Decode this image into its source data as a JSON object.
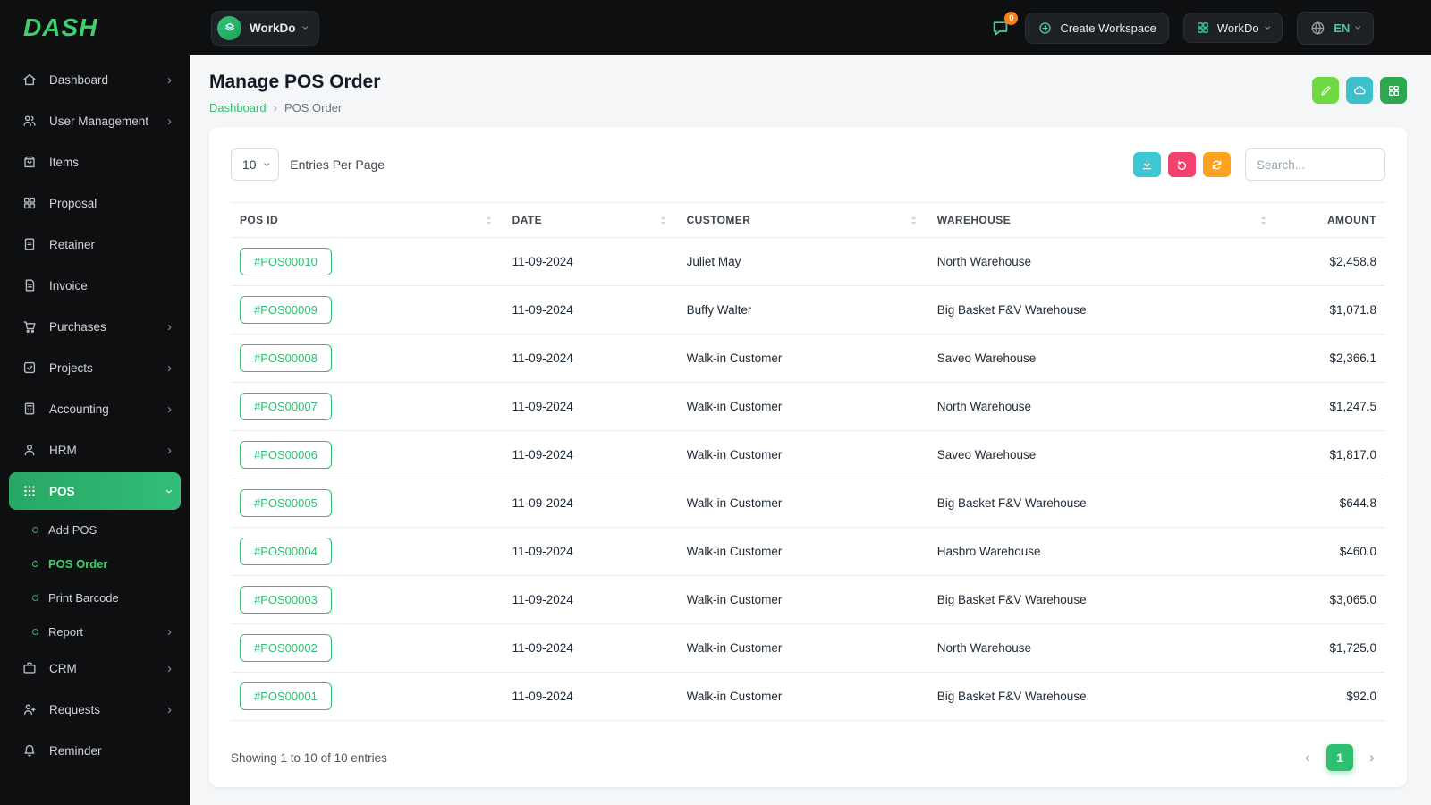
{
  "theme": {
    "accent_green": "#2fbf71",
    "brand_lime": "#6fd943",
    "sidebar_bg": "#0e0f11",
    "badge_orange": "#fd7e14",
    "button_teal": "#3cc7d4",
    "button_pink": "#f1416c",
    "button_orange": "#ffa21d"
  },
  "brand": {
    "logo": "DASH"
  },
  "topbar": {
    "workspace": {
      "label": "WorkDo"
    },
    "messages_badge": "0",
    "create_workspace": "Create Workspace",
    "company_menu": "WorkDo",
    "language": "EN"
  },
  "sidebar": {
    "items": [
      {
        "label": "Dashboard"
      },
      {
        "label": "User Management"
      },
      {
        "label": "Items"
      },
      {
        "label": "Proposal"
      },
      {
        "label": "Retainer"
      },
      {
        "label": "Invoice"
      },
      {
        "label": "Purchases"
      },
      {
        "label": "Projects"
      },
      {
        "label": "Accounting"
      },
      {
        "label": "HRM"
      },
      {
        "label": "POS"
      },
      {
        "label": "CRM"
      },
      {
        "label": "Requests"
      },
      {
        "label": "Reminder"
      }
    ],
    "pos_submenu": [
      {
        "label": "Add POS"
      },
      {
        "label": "POS Order"
      },
      {
        "label": "Print Barcode"
      },
      {
        "label": "Report"
      }
    ]
  },
  "page": {
    "title": "Manage POS Order",
    "breadcrumb": {
      "home": "Dashboard",
      "separator": "›",
      "current": "POS Order"
    }
  },
  "card": {
    "entries_value": "10",
    "entries_label": "Entries Per Page",
    "search_placeholder": "Search...",
    "table": {
      "headers": [
        "POS ID",
        "DATE",
        "CUSTOMER",
        "WAREHOUSE",
        "AMOUNT"
      ],
      "rows": [
        {
          "id": "#POS00010",
          "date": "11-09-2024",
          "customer": "Juliet May",
          "warehouse": "North Warehouse",
          "amount": "$2,458.8"
        },
        {
          "id": "#POS00009",
          "date": "11-09-2024",
          "customer": "Buffy Walter",
          "warehouse": "Big Basket F&V Warehouse",
          "amount": "$1,071.8"
        },
        {
          "id": "#POS00008",
          "date": "11-09-2024",
          "customer": "Walk-in Customer",
          "warehouse": "Saveo Warehouse",
          "amount": "$2,366.1"
        },
        {
          "id": "#POS00007",
          "date": "11-09-2024",
          "customer": "Walk-in Customer",
          "warehouse": "North Warehouse",
          "amount": "$1,247.5"
        },
        {
          "id": "#POS00006",
          "date": "11-09-2024",
          "customer": "Walk-in Customer",
          "warehouse": "Saveo Warehouse",
          "amount": "$1,817.0"
        },
        {
          "id": "#POS00005",
          "date": "11-09-2024",
          "customer": "Walk-in Customer",
          "warehouse": "Big Basket F&V Warehouse",
          "amount": "$644.8"
        },
        {
          "id": "#POS00004",
          "date": "11-09-2024",
          "customer": "Walk-in Customer",
          "warehouse": "Hasbro Warehouse",
          "amount": "$460.0"
        },
        {
          "id": "#POS00003",
          "date": "11-09-2024",
          "customer": "Walk-in Customer",
          "warehouse": "Big Basket F&V Warehouse",
          "amount": "$3,065.0"
        },
        {
          "id": "#POS00002",
          "date": "11-09-2024",
          "customer": "Walk-in Customer",
          "warehouse": "North Warehouse",
          "amount": "$1,725.0"
        },
        {
          "id": "#POS00001",
          "date": "11-09-2024",
          "customer": "Walk-in Customer",
          "warehouse": "Big Basket F&V Warehouse",
          "amount": "$92.0"
        }
      ]
    },
    "footer": {
      "showing": "Showing 1 to 10 of 10 entries",
      "page": "1"
    }
  }
}
